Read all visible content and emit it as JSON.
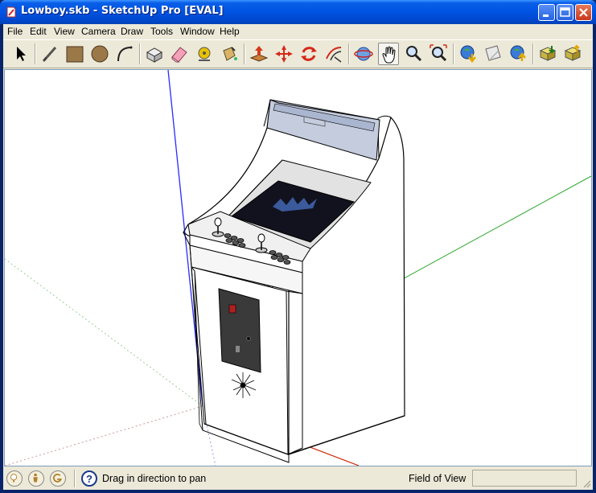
{
  "window": {
    "title": "Lowboy.skb - SketchUp Pro [EVAL]"
  },
  "menu": [
    "File",
    "Edit",
    "View",
    "Camera",
    "Draw",
    "Tools",
    "Window",
    "Help"
  ],
  "toolbar": {
    "tools": [
      {
        "name": "select-icon"
      },
      {
        "name": "pencil-line-icon"
      },
      {
        "name": "rectangle-icon"
      },
      {
        "name": "circle-icon"
      },
      {
        "name": "arc-icon"
      },
      {
        "name": "make-component-icon"
      },
      {
        "name": "eraser-icon"
      },
      {
        "name": "tape-measure-icon"
      },
      {
        "name": "paint-bucket-icon"
      },
      {
        "name": "push-pull-icon"
      },
      {
        "name": "move-icon"
      },
      {
        "name": "rotate-icon"
      },
      {
        "name": "offset-icon"
      },
      {
        "name": "orbit-icon"
      },
      {
        "name": "pan-icon",
        "active": true
      },
      {
        "name": "zoom-icon"
      },
      {
        "name": "zoom-extents-icon"
      },
      {
        "name": "get-models-icon"
      },
      {
        "name": "share-model-icon"
      },
      {
        "name": "google-earth-icon"
      },
      {
        "name": "get-components-icon"
      },
      {
        "name": "share-component-icon"
      }
    ]
  },
  "status": {
    "icons": [
      "geo-location-icon",
      "credits-icon",
      "google-icon"
    ],
    "help_icon": "help-icon",
    "message": "Drag in direction to pan",
    "fov_label": "Field of View",
    "fov_value": ""
  },
  "colors": {
    "titlebar": "#0054e3",
    "chrome": "#ece9d8",
    "axis_red": "#cc2200",
    "axis_green": "#2fa82f",
    "axis_blue": "#2a2aff"
  }
}
